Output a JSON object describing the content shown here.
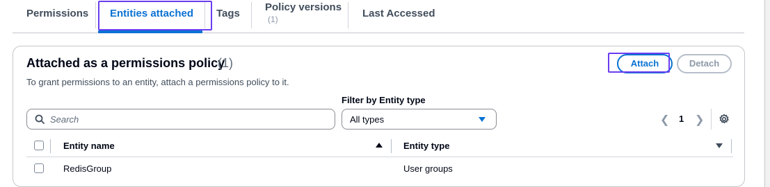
{
  "tabs": [
    {
      "label": "Permissions"
    },
    {
      "label": "Entities attached",
      "active": true
    },
    {
      "label": "Tags"
    },
    {
      "label": "Policy versions",
      "sub": "(1)"
    },
    {
      "label": "Last Accessed"
    }
  ],
  "card": {
    "title": "Attached as a permissions policy",
    "count": "(1)",
    "description": "To grant permissions to an entity, attach a permissions policy to it.",
    "attach_label": "Attach",
    "detach_label": "Detach"
  },
  "filter": {
    "search_placeholder": "Search",
    "entity_type_label": "Filter by Entity type",
    "entity_type_value": "All types"
  },
  "pagination": {
    "current_page": "1"
  },
  "table": {
    "columns": [
      "Entity name",
      "Entity type"
    ],
    "rows": [
      {
        "name": "RedisGroup",
        "type": "User groups"
      }
    ]
  },
  "colors": {
    "accent": "#0972d3",
    "highlight": "#6a3df0"
  },
  "icons": [
    "search-icon",
    "caret-down-icon",
    "chevron-left-icon",
    "chevron-right-icon",
    "gear-icon",
    "sort-ascending-icon",
    "sort-descending-icon"
  ]
}
